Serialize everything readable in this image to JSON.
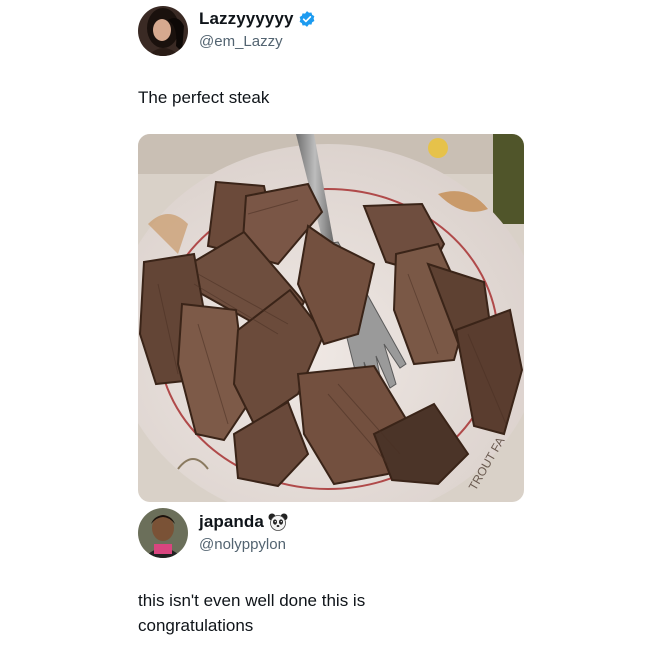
{
  "tweet": {
    "display_name": "Lazzyyyyyy",
    "handle": "@em_Lazzy",
    "verified": true,
    "text": "The perfect steak",
    "avatar_icon": "avatar-photo-woman",
    "photo_icon": "steak-plate-photo",
    "plate_rim_text": "TROUT FA"
  },
  "reply": {
    "display_name": "japanda",
    "name_emoji": "panda-emoji",
    "handle": "@nolyppylon",
    "text": "this isn't even well done this is congratulations",
    "avatar_icon": "avatar-photo-man"
  },
  "colors": {
    "verified_blue": "#1d9bf0",
    "handle_gray": "#536471",
    "text": "#0f1419"
  }
}
